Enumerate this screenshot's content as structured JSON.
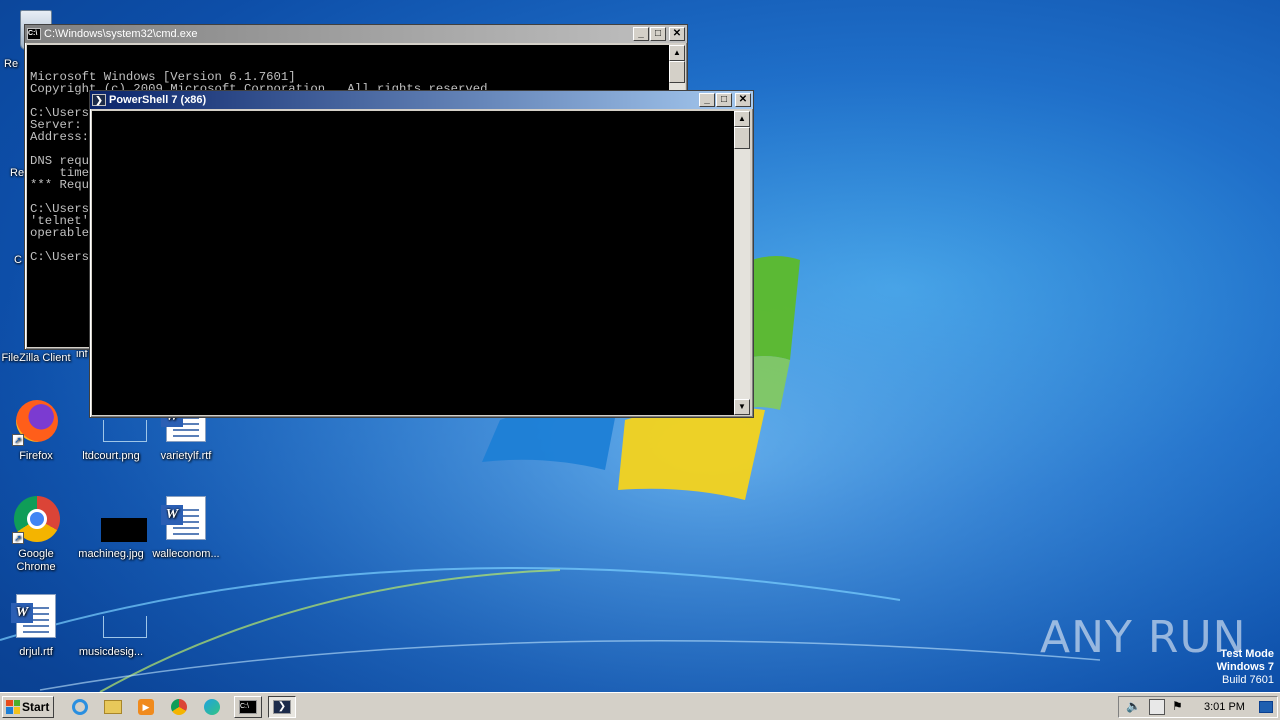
{
  "desktop": {
    "icons": [
      {
        "label": "Re"
      },
      {
        "label": "Re"
      },
      {
        "label": "C"
      },
      {
        "label": "FileZilla Client"
      },
      {
        "label": "inf"
      },
      {
        "label": "Firefox"
      },
      {
        "label": "ltdcourt.png"
      },
      {
        "label": "varietylf.rtf"
      },
      {
        "label": "Google Chrome"
      },
      {
        "label": "machineg.jpg"
      },
      {
        "label": "walleconom..."
      },
      {
        "label": "drjul.rtf"
      },
      {
        "label": "musicdesig..."
      }
    ]
  },
  "cmd_window": {
    "title": "C:\\Windows\\system32\\cmd.exe",
    "lines": [
      "Microsoft Windows [Version 6.1.7601]",
      "Copyright (c) 2009 Microsoft Corporation.  All rights reserved.",
      "",
      "C:\\Users\\admin>nslookup 92.203.222.80",
      "Server:",
      "Address:",
      "",
      "DNS requ",
      "    time",
      "*** Requ",
      "",
      "C:\\Users",
      "'telnet'",
      "operable",
      "",
      "C:\\Users"
    ],
    "buttons": {
      "minimize": "_",
      "maximize": "□",
      "close": "✕"
    }
  },
  "powershell_window": {
    "title": "PowerShell 7 (x86)",
    "buttons": {
      "minimize": "_",
      "maximize": "□",
      "close": "✕"
    }
  },
  "taskbar": {
    "start_label": "Start",
    "clock": "3:01 PM",
    "quick_launch": [
      "ie-icon",
      "explorer-icon",
      "media-player-icon",
      "chrome-icon",
      "edge-icon"
    ],
    "tasks": [
      "cmd-icon",
      "powershell-icon"
    ]
  },
  "watermark": {
    "line1": "Test Mode",
    "line2": "Windows 7",
    "line3": "Build 7601",
    "brand": "ANY RUN"
  },
  "colors": {
    "console_bg": "#000000",
    "active_title": "#0a246a",
    "inactive_title": "#808080",
    "desktop": "#1f6fc9"
  }
}
